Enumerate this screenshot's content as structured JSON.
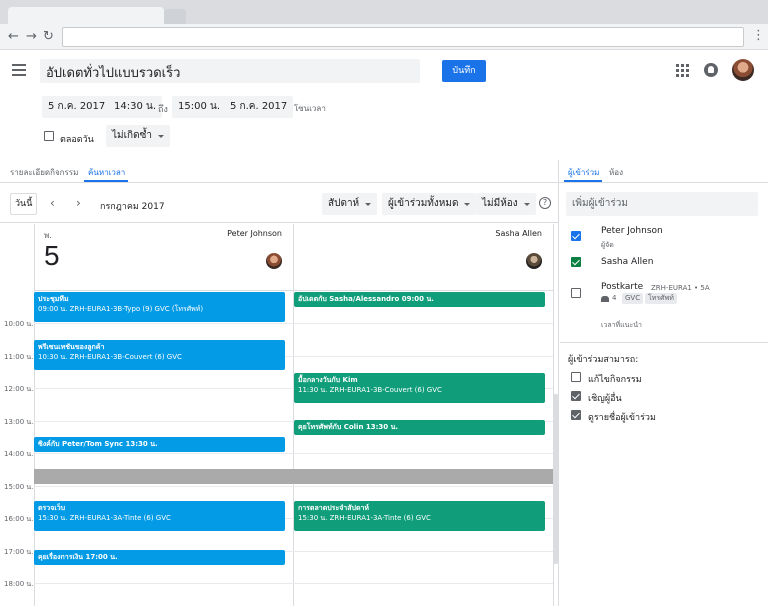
{
  "header": {
    "title": "อัปเดตทั่วไปแบบรวดเร็ว",
    "save_label": "บันทึก"
  },
  "datetime": {
    "start_date": "5 ก.ค. 2017",
    "start_time": "14:30 น.",
    "to_label": "ถึง",
    "end_time": "15:00 น.",
    "end_date": "5 ก.ค. 2017",
    "timezone_label": "โซนเวลา",
    "allday_label": "ตลอดวัน",
    "repeat_label": "ไม่เกิดซ้ำ"
  },
  "tabs": {
    "details": "รายละเอียดกิจกรรม",
    "find_time": "ค้นหาเวลา",
    "guests": "ผู้เข้าร่วม",
    "rooms": "ห้อง"
  },
  "calendar_toolbar": {
    "today": "วันนี้",
    "month": "กรกฎาคม 2017",
    "view": "สัปดาห์",
    "all_guests": "ผู้เข้าร่วมทั้งหมด",
    "no_rooms": "ไม่มีห้อง",
    "help": "?"
  },
  "day": {
    "abbr": "พ.",
    "number": "5"
  },
  "columns": [
    "Peter Johnson",
    "Sasha Allen"
  ],
  "hours": [
    "10:00 น.",
    "11:00 น.",
    "12:00 น.",
    "13:00 น.",
    "14:00 น.",
    "15:00 น.",
    "16:00 น.",
    "17:00 น.",
    "18:00 น."
  ],
  "events_peter": [
    {
      "title": "ประชุมทีม",
      "sub": "09:00 น. ZRH-EURA1-3B-Typo (9) GVC (โทรศัพท์)"
    },
    {
      "title": "พรีเซนเทชันของลูกค้า",
      "sub": "10:30 น. ZRH-EURA1-3B-Couvert (6) GVC"
    },
    {
      "title": "ซิงค์กับ Peter/Tom Sync 13:30 น.",
      "sub": ""
    },
    {
      "title": "ตรวจเว็บ",
      "sub": "15:30 น. ZRH-EURA1-3A-Tinte (6) GVC"
    },
    {
      "title": "คุยเรื่องการเงิน 17:00 น.",
      "sub": ""
    }
  ],
  "events_sasha": [
    {
      "title": "อัปเดตกับ Sasha/Alessandro 09:00 น.",
      "sub": ""
    },
    {
      "title": "มื้อกลางวันกับ Kim",
      "sub": "11:30 น. ZRH-EURA1-3B-Couvert (6) GVC"
    },
    {
      "title": "คุยโทรศัพท์กับ Colin 13:30 น.",
      "sub": ""
    },
    {
      "title": "การตลาดประจำสัปดาห์",
      "sub": "15:30 น. ZRH-EURA1-3A-Tinte (6) GVC"
    }
  ],
  "guests_panel": {
    "add_placeholder": "เพิ่มผู้เข้าร่วม",
    "guest1_name": "Peter Johnson",
    "guest1_role": "ผู้จัด",
    "guest2_name": "Sasha Allen",
    "room_name": "Postkarte",
    "room_code": "ZRH-EURA1 • 5A",
    "room_capacity": "4",
    "room_tag1": "GVC",
    "room_tag2": "โทรศัพท์",
    "suggested_times": "เวลาที่แนะนำ",
    "permissions_title": "ผู้เข้าร่วมสามารถ:",
    "perm_modify": "แก้ไขกิจกรรม",
    "perm_invite": "เชิญผู้อื่น",
    "perm_see_list": "ดูรายชื่อผู้เข้าร่วม"
  },
  "colors": {
    "accent": "#1a73e8",
    "event_blue": "#039be5",
    "event_green": "#0f9d7a"
  }
}
